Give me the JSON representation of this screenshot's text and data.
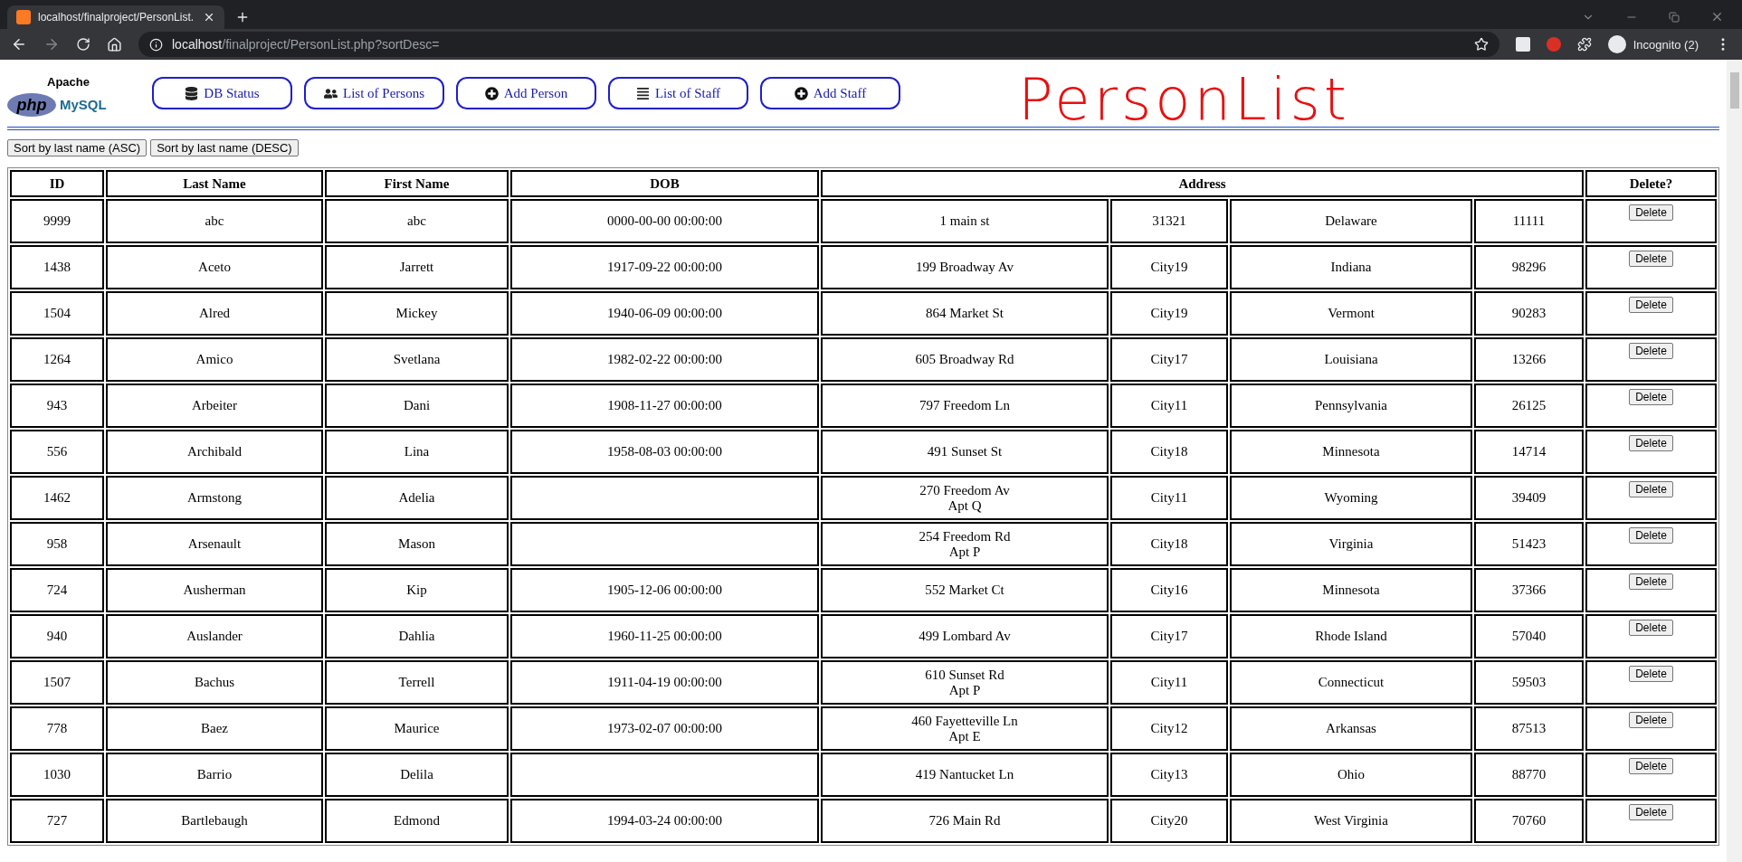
{
  "browser": {
    "tab": {
      "title": "localhost/finalproject/PersonList.",
      "selected": true
    },
    "url_host": "localhost",
    "url_path": "/finalproject/PersonList.php?sortDesc=",
    "profile": "Incognito (2)"
  },
  "logo": {
    "top": "Apache",
    "left": "php",
    "right": "MySQL"
  },
  "nav": [
    {
      "label": "DB Status",
      "kind": "database"
    },
    {
      "label": "List of Persons",
      "kind": "people"
    },
    {
      "label": "Add Person",
      "kind": "add"
    },
    {
      "label": "List of Staff",
      "kind": "list"
    },
    {
      "label": "Add Staff",
      "kind": "add"
    }
  ],
  "page_heading": "PersonList",
  "sort_buttons": [
    "Sort by last name (ASC)",
    "Sort by last name (DESC)"
  ],
  "table": {
    "columns": [
      "ID",
      "Last Name",
      "First Name",
      "DOB",
      "Address",
      "Delete?"
    ],
    "rows": [
      {
        "id": "9999",
        "last_name": "abc",
        "first_name": "abc",
        "dob": "0000-00-00 00:00:00",
        "street": "1 main st",
        "city": "31321",
        "state": "Delaware",
        "zip": "11111",
        "action": "Delete"
      },
      {
        "id": "1438",
        "last_name": "Aceto",
        "first_name": "Jarrett",
        "dob": "1917-09-22 00:00:00",
        "street": "199 Broadway Av",
        "city": "City19",
        "state": "Indiana",
        "zip": "98296",
        "action": "Delete"
      },
      {
        "id": "1504",
        "last_name": "Alred",
        "first_name": "Mickey",
        "dob": "1940-06-09 00:00:00",
        "street": "864 Market St",
        "city": "City19",
        "state": "Vermont",
        "zip": "90283",
        "action": "Delete"
      },
      {
        "id": "1264",
        "last_name": "Amico",
        "first_name": "Svetlana",
        "dob": "1982-02-22 00:00:00",
        "street": "605 Broadway Rd",
        "city": "City17",
        "state": "Louisiana",
        "zip": "13266",
        "action": "Delete"
      },
      {
        "id": "943",
        "last_name": "Arbeiter",
        "first_name": "Dani",
        "dob": "1908-11-27 00:00:00",
        "street": "797 Freedom Ln",
        "city": "City11",
        "state": "Pennsylvania",
        "zip": "26125",
        "action": "Delete"
      },
      {
        "id": "556",
        "last_name": "Archibald",
        "first_name": "Lina",
        "dob": "1958-08-03 00:00:00",
        "street": "491 Sunset St",
        "city": "City18",
        "state": "Minnesota",
        "zip": "14714",
        "action": "Delete"
      },
      {
        "id": "1462",
        "last_name": "Armstong",
        "first_name": "Adelia",
        "street": "270 Freedom Av\nApt Q",
        "city": "City11",
        "state": "Wyoming",
        "zip": "39409",
        "action": "Delete"
      },
      {
        "id": "958",
        "last_name": "Arsenault",
        "first_name": "Mason",
        "street": "254 Freedom Rd\nApt P",
        "city": "City18",
        "state": "Virginia",
        "zip": "51423",
        "action": "Delete"
      },
      {
        "id": "724",
        "last_name": "Ausherman",
        "first_name": "Kip",
        "dob": "1905-12-06 00:00:00",
        "street": "552 Market Ct",
        "city": "City16",
        "state": "Minnesota",
        "zip": "37366",
        "action": "Delete"
      },
      {
        "id": "940",
        "last_name": "Auslander",
        "first_name": "Dahlia",
        "dob": "1960-11-25 00:00:00",
        "street": "499 Lombard Av",
        "city": "City17",
        "state": "Rhode Island",
        "zip": "57040",
        "action": "Delete"
      },
      {
        "id": "1507",
        "last_name": "Bachus",
        "first_name": "Terrell",
        "dob": "1911-04-19 00:00:00",
        "street": "610 Sunset Rd\nApt P",
        "city": "City11",
        "state": "Connecticut",
        "zip": "59503",
        "action": "Delete"
      },
      {
        "id": "778",
        "last_name": "Baez",
        "first_name": "Maurice",
        "dob": "1973-02-07 00:00:00",
        "street": "460 Fayetteville Ln\nApt E",
        "city": "City12",
        "state": "Arkansas",
        "zip": "87513",
        "action": "Delete"
      },
      {
        "id": "1030",
        "last_name": "Barrio",
        "first_name": "Delila",
        "street": "419 Nantucket Ln",
        "city": "City13",
        "state": "Ohio",
        "zip": "88770",
        "action": "Delete"
      },
      {
        "id": "727",
        "last_name": "Bartlebaugh",
        "first_name": "Edmond",
        "dob": "1994-03-24 00:00:00",
        "street": "726 Main Rd",
        "city": "City20",
        "state": "West Virginia",
        "zip": "70760",
        "action": "Delete"
      }
    ]
  }
}
